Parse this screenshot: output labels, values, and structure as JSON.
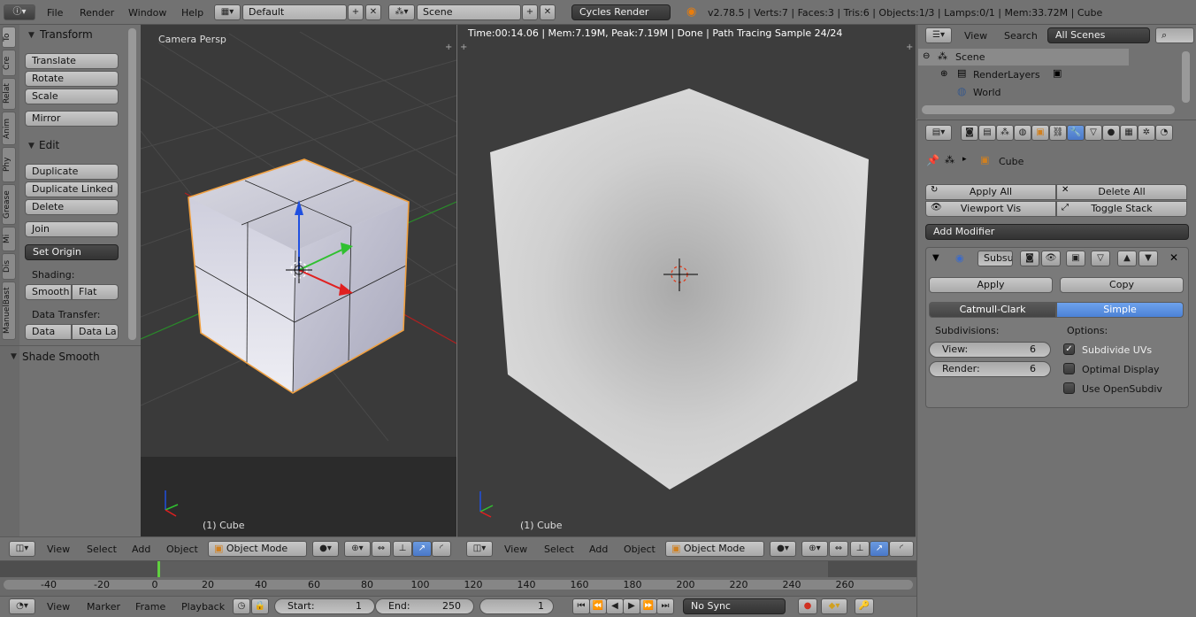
{
  "top_header": {
    "menus": [
      "File",
      "Render",
      "Window",
      "Help"
    ],
    "layout": "Default",
    "scene": "Scene",
    "engine": "Cycles Render",
    "stats": "v2.78.5 | Verts:7 | Faces:3 | Tris:6 | Objects:1/3 | Lamps:0/1 | Mem:33.72M | Cube"
  },
  "tool_tabs": [
    "To",
    "Cre",
    "Relat",
    "Anim",
    "Phy",
    "Grease",
    "Mi",
    "Dis",
    "ManuelBast"
  ],
  "toolshelf": {
    "transform_title": "Transform",
    "translate": "Translate",
    "rotate": "Rotate",
    "scale": "Scale",
    "mirror": "Mirror",
    "edit_title": "Edit",
    "duplicate": "Duplicate",
    "duplicate_linked": "Duplicate Linked",
    "delete": "Delete",
    "join": "Join",
    "set_origin": "Set Origin",
    "shading_label": "Shading:",
    "smooth": "Smooth",
    "flat": "Flat",
    "data_transfer_label": "Data Transfer:",
    "data": "Data",
    "data_la": "Data La",
    "operator_panel": "Shade Smooth"
  },
  "viewport_left": {
    "label": "Camera Persp",
    "object": "(1) Cube",
    "header": {
      "view": "View",
      "select": "Select",
      "add": "Add",
      "object": "Object",
      "mode": "Object Mode"
    }
  },
  "viewport_right": {
    "status": "Time:00:14.06 | Mem:7.19M, Peak:7.19M | Done | Path Tracing Sample 24/24",
    "object": "(1) Cube",
    "header": {
      "view": "View",
      "select": "Select",
      "add": "Add",
      "object": "Object",
      "mode": "Object Mode"
    }
  },
  "outliner": {
    "view": "View",
    "search": "Search",
    "filter": "All Scenes",
    "items": [
      "Scene",
      "RenderLayers",
      "World"
    ]
  },
  "properties": {
    "object_name": "Cube",
    "apply_all": "Apply All",
    "delete_all": "Delete All",
    "viewport_vis": "Viewport Vis",
    "toggle_stack": "Toggle Stack",
    "add_modifier": "Add Modifier",
    "modifier_name": "Subsu",
    "apply": "Apply",
    "copy": "Copy",
    "catmull": "Catmull-Clark",
    "simple": "Simple",
    "subdivisions_label": "Subdivisions:",
    "options_label": "Options:",
    "view_label": "View:",
    "view_value": "6",
    "render_label": "Render:",
    "render_value": "6",
    "subdivide_uvs": "Subdivide UVs",
    "optimal_display": "Optimal Display",
    "use_opensubdiv": "Use OpenSubdiv"
  },
  "timeline": {
    "ticks": [
      "-40",
      "-20",
      "0",
      "20",
      "40",
      "60",
      "80",
      "100",
      "120",
      "140",
      "160",
      "180",
      "200",
      "220",
      "240",
      "260"
    ],
    "view": "View",
    "marker": "Marker",
    "frame": "Frame",
    "playback": "Playback",
    "start_label": "Start:",
    "start_value": "1",
    "end_label": "End:",
    "end_value": "250",
    "current": "1",
    "sync": "No Sync"
  }
}
